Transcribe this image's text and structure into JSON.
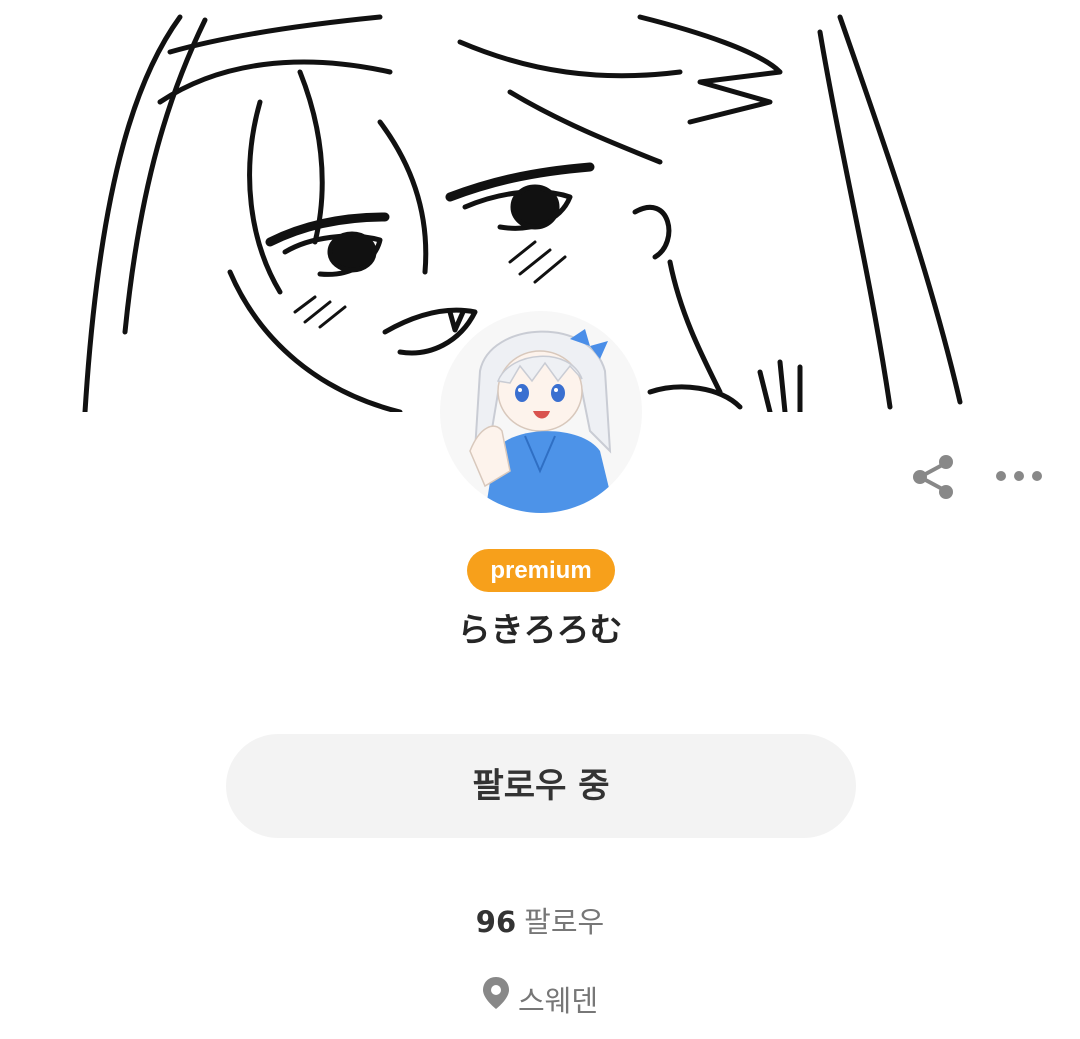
{
  "profile": {
    "badge": "premium",
    "username": "らきろろむ",
    "follow_button": "팔로우 중",
    "followers_count": "96",
    "followers_label": "팔로우",
    "location": "스웨덴"
  },
  "icons": {
    "share": "share-icon",
    "more": "more-horizontal-icon",
    "location": "location-pin-icon"
  },
  "colors": {
    "badge": "#f7a01b",
    "button_bg": "#f3f3f3",
    "icon": "#888888",
    "text": "#262626",
    "muted": "#777777"
  }
}
